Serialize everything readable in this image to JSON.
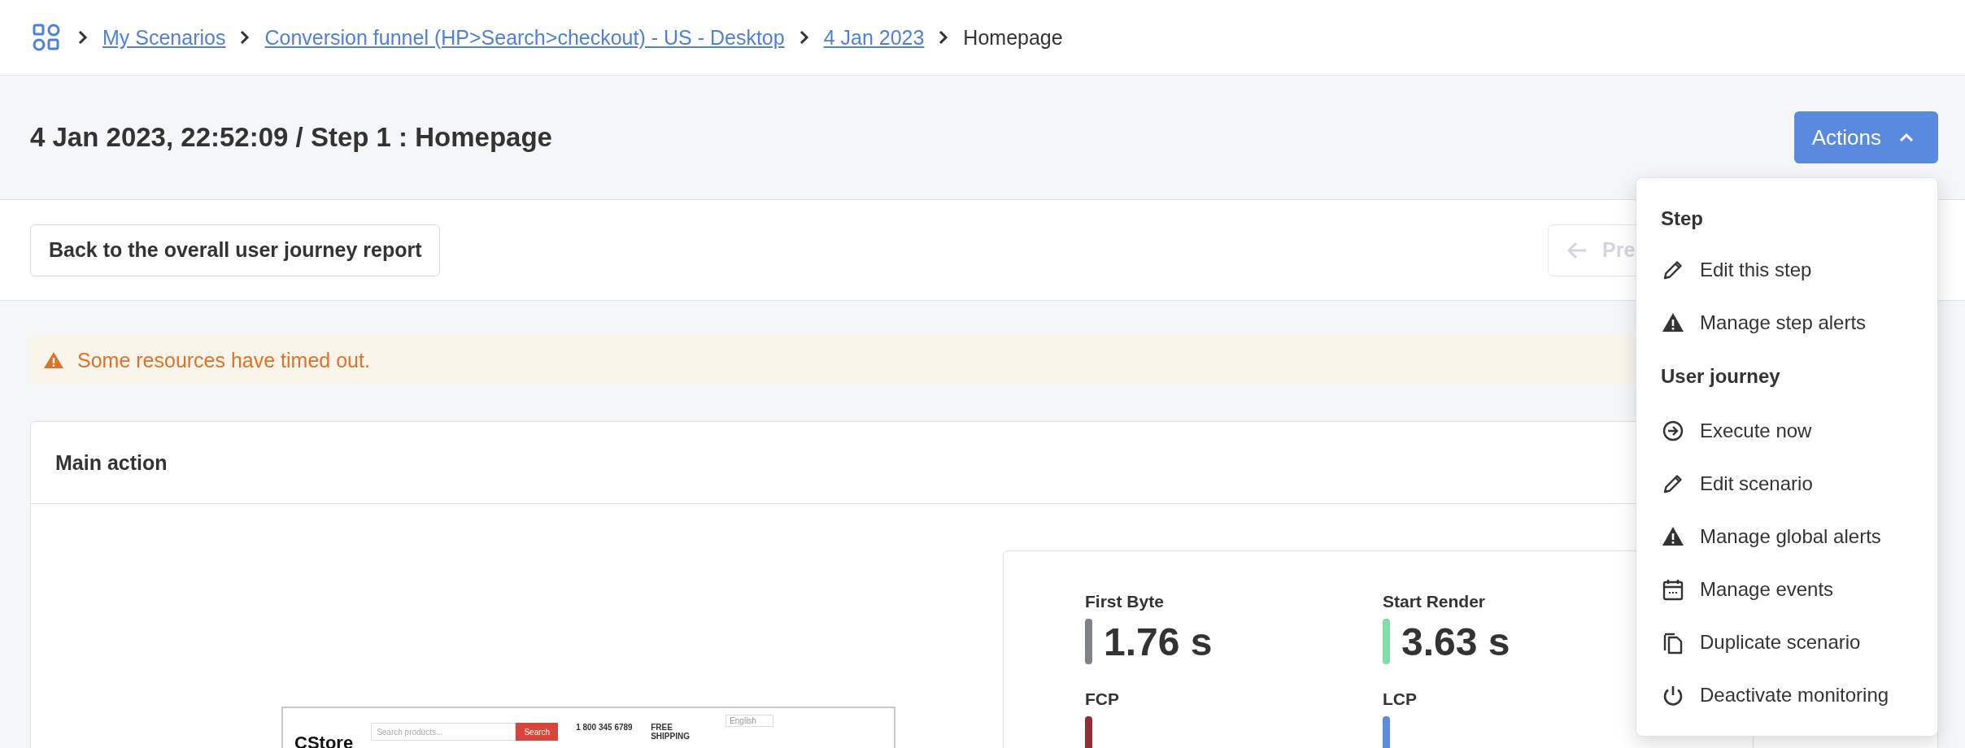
{
  "breadcrumb": [
    {
      "label": "My Scenarios",
      "link": true
    },
    {
      "label": "Conversion funnel (HP>Search>checkout) - US - Desktop",
      "link": true
    },
    {
      "label": "4 Jan 2023",
      "link": true
    },
    {
      "label": "Homepage",
      "link": false
    }
  ],
  "title": "4 Jan 2023, 22:52:09 / Step 1 : Homepage",
  "actions_button": {
    "label": "Actions",
    "expanded": true
  },
  "back_button": "Back to the overall user journey report",
  "prev_button": "Pre",
  "warning": "Some resources have timed out.",
  "card": {
    "title": "Main action",
    "thumbnail": {
      "logo": "CStore",
      "search_placeholder": "Search products...",
      "search_button": "Search",
      "phone": "1 800 345 6789",
      "shipping": "FREE SHIPPING",
      "language": "English"
    },
    "metrics": [
      {
        "label": "First Byte",
        "value": "1.76 s",
        "color": "#808289"
      },
      {
        "label": "Start Render",
        "value": "3.63 s",
        "color": "#80deaa"
      },
      {
        "label": "FCP",
        "color": "#8e2f3a"
      },
      {
        "label": "LCP",
        "color": "#5a8ce0"
      }
    ]
  },
  "menu": [
    {
      "kind": "header",
      "label": "Step"
    },
    {
      "kind": "item",
      "label": "Edit this step"
    },
    {
      "kind": "item",
      "label": "Manage step alerts"
    },
    {
      "kind": "header",
      "label": "User journey"
    },
    {
      "kind": "item",
      "label": "Execute now"
    },
    {
      "kind": "item",
      "label": "Edit scenario"
    },
    {
      "kind": "item",
      "label": "Manage global alerts"
    },
    {
      "kind": "item",
      "label": "Manage events"
    },
    {
      "kind": "item",
      "label": "Duplicate scenario"
    },
    {
      "kind": "item",
      "label": "Deactivate monitoring"
    }
  ]
}
